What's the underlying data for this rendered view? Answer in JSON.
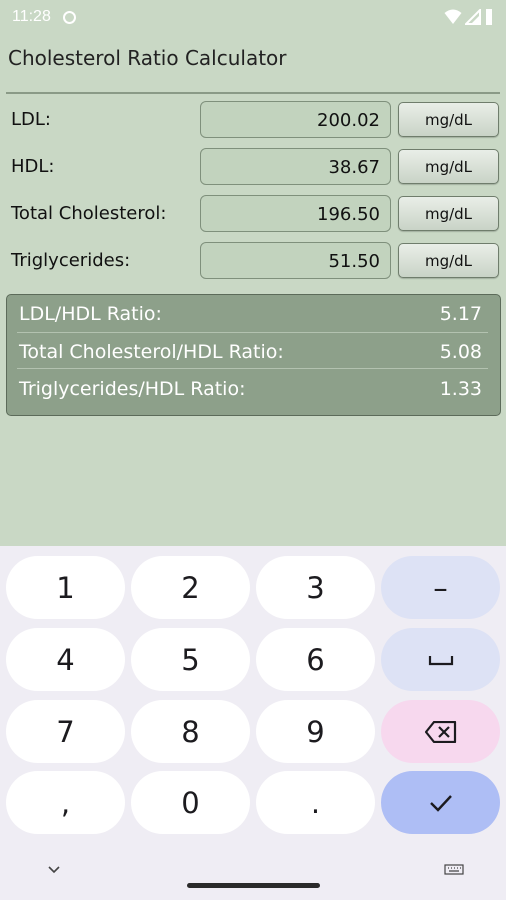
{
  "status_bar": {
    "time": "11:28"
  },
  "app": {
    "title": "Cholesterol Ratio Calculator"
  },
  "inputs": [
    {
      "label": "LDL:",
      "value": "200.02",
      "unit": "mg/dL"
    },
    {
      "label": "HDL:",
      "value": "38.67",
      "unit": "mg/dL"
    },
    {
      "label": "Total Cholesterol:",
      "value": "196.50",
      "unit": "mg/dL"
    },
    {
      "label": "Triglycerides:",
      "value": "51.50",
      "unit": "mg/dL"
    }
  ],
  "results": [
    {
      "label": "LDL/HDL Ratio:",
      "value": "5.17"
    },
    {
      "label": "Total Cholesterol/HDL Ratio:",
      "value": "5.08"
    },
    {
      "label": "Triglycerides/HDL Ratio:",
      "value": "1.33"
    }
  ],
  "keyboard": {
    "keys": [
      "1",
      "2",
      "3",
      "4",
      "5",
      "6",
      "7",
      "8",
      "9",
      ",",
      "0",
      "."
    ],
    "minus": "–"
  },
  "colors": {
    "background": "#c9d8c5",
    "results_panel": "#8da08a",
    "keyboard_bg": "#efedf4",
    "key_confirm": "#aebef5",
    "key_delete": "#f7d8ee"
  }
}
